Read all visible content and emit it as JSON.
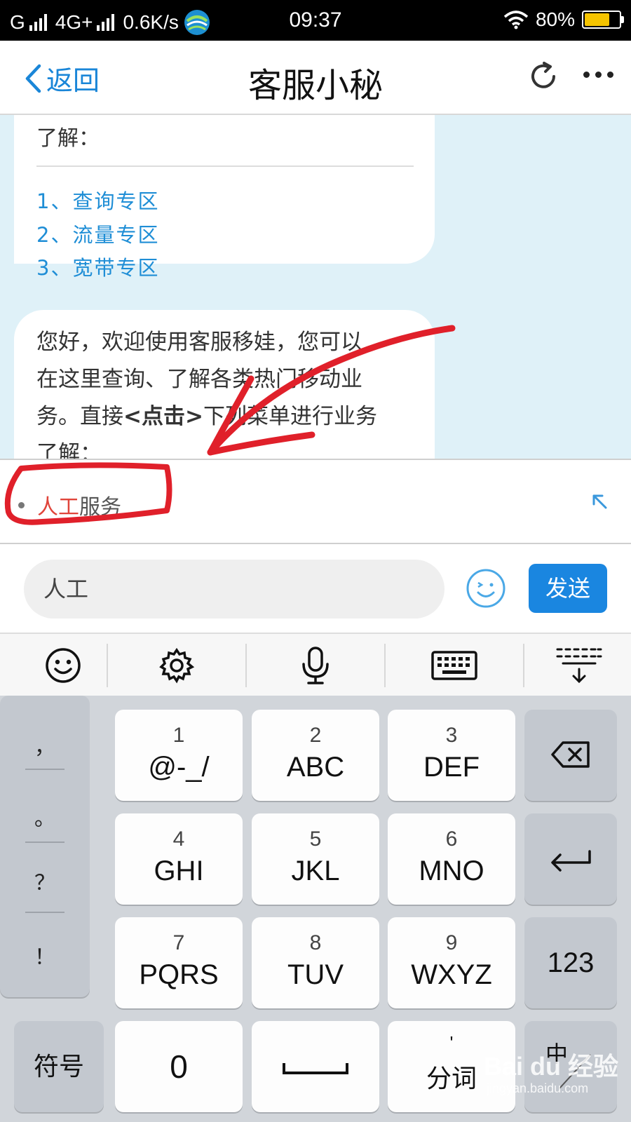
{
  "status_bar": {
    "carrier1": "G",
    "network": "4G+",
    "speed": "0.6K/s",
    "time": "09:37",
    "battery": "80%",
    "battery_level": 0.8,
    "battery_color": "#f5c400"
  },
  "nav": {
    "back_label": "返回",
    "title": "客服小秘",
    "refresh_icon": "refresh-icon",
    "more_icon": "more-icon"
  },
  "chat": {
    "bubble1": {
      "tail_text": "了解：",
      "options": [
        "1、查询专区",
        "2、流量专区",
        "3、宽带专区"
      ]
    },
    "bubble2": {
      "line1": "您好，欢迎使用客服移娃，您可以",
      "line2": "在这里查询、了解各类热门移动业",
      "line3_pre": "务。直接",
      "line3_bold": "<点击>",
      "line3_post": "下列菜单进行业务",
      "line4": "了解："
    }
  },
  "suggestion": {
    "highlight": "人工",
    "rest": "服务",
    "highlight_color": "#e0443a"
  },
  "input": {
    "value": "人工",
    "send_label": "发送",
    "accent": "#1a86e0"
  },
  "keyboard": {
    "toolbar_icons": [
      "emoji-icon",
      "settings-icon",
      "microphone-icon",
      "keyboard-icon",
      "collapse-keyboard-icon"
    ],
    "punctuation": [
      "，",
      "。",
      "？",
      "！"
    ],
    "keys": [
      {
        "num": "1",
        "letters": "@-_/"
      },
      {
        "num": "2",
        "letters": "ABC"
      },
      {
        "num": "3",
        "letters": "DEF"
      },
      {
        "num": "4",
        "letters": "GHI"
      },
      {
        "num": "5",
        "letters": "JKL"
      },
      {
        "num": "6",
        "letters": "MNO"
      },
      {
        "num": "7",
        "letters": "PQRS"
      },
      {
        "num": "8",
        "letters": "TUV"
      },
      {
        "num": "9",
        "letters": "WXYZ"
      }
    ],
    "symbols_label": "符号",
    "zero_label": "0",
    "numbers_label": "123",
    "split_top": "'",
    "split_label": "分词",
    "lang_label": "中",
    "annotation_color": "#e0202a"
  },
  "watermark": {
    "brand": "Bai du 经验",
    "url": "jingyan.baidu.com"
  }
}
